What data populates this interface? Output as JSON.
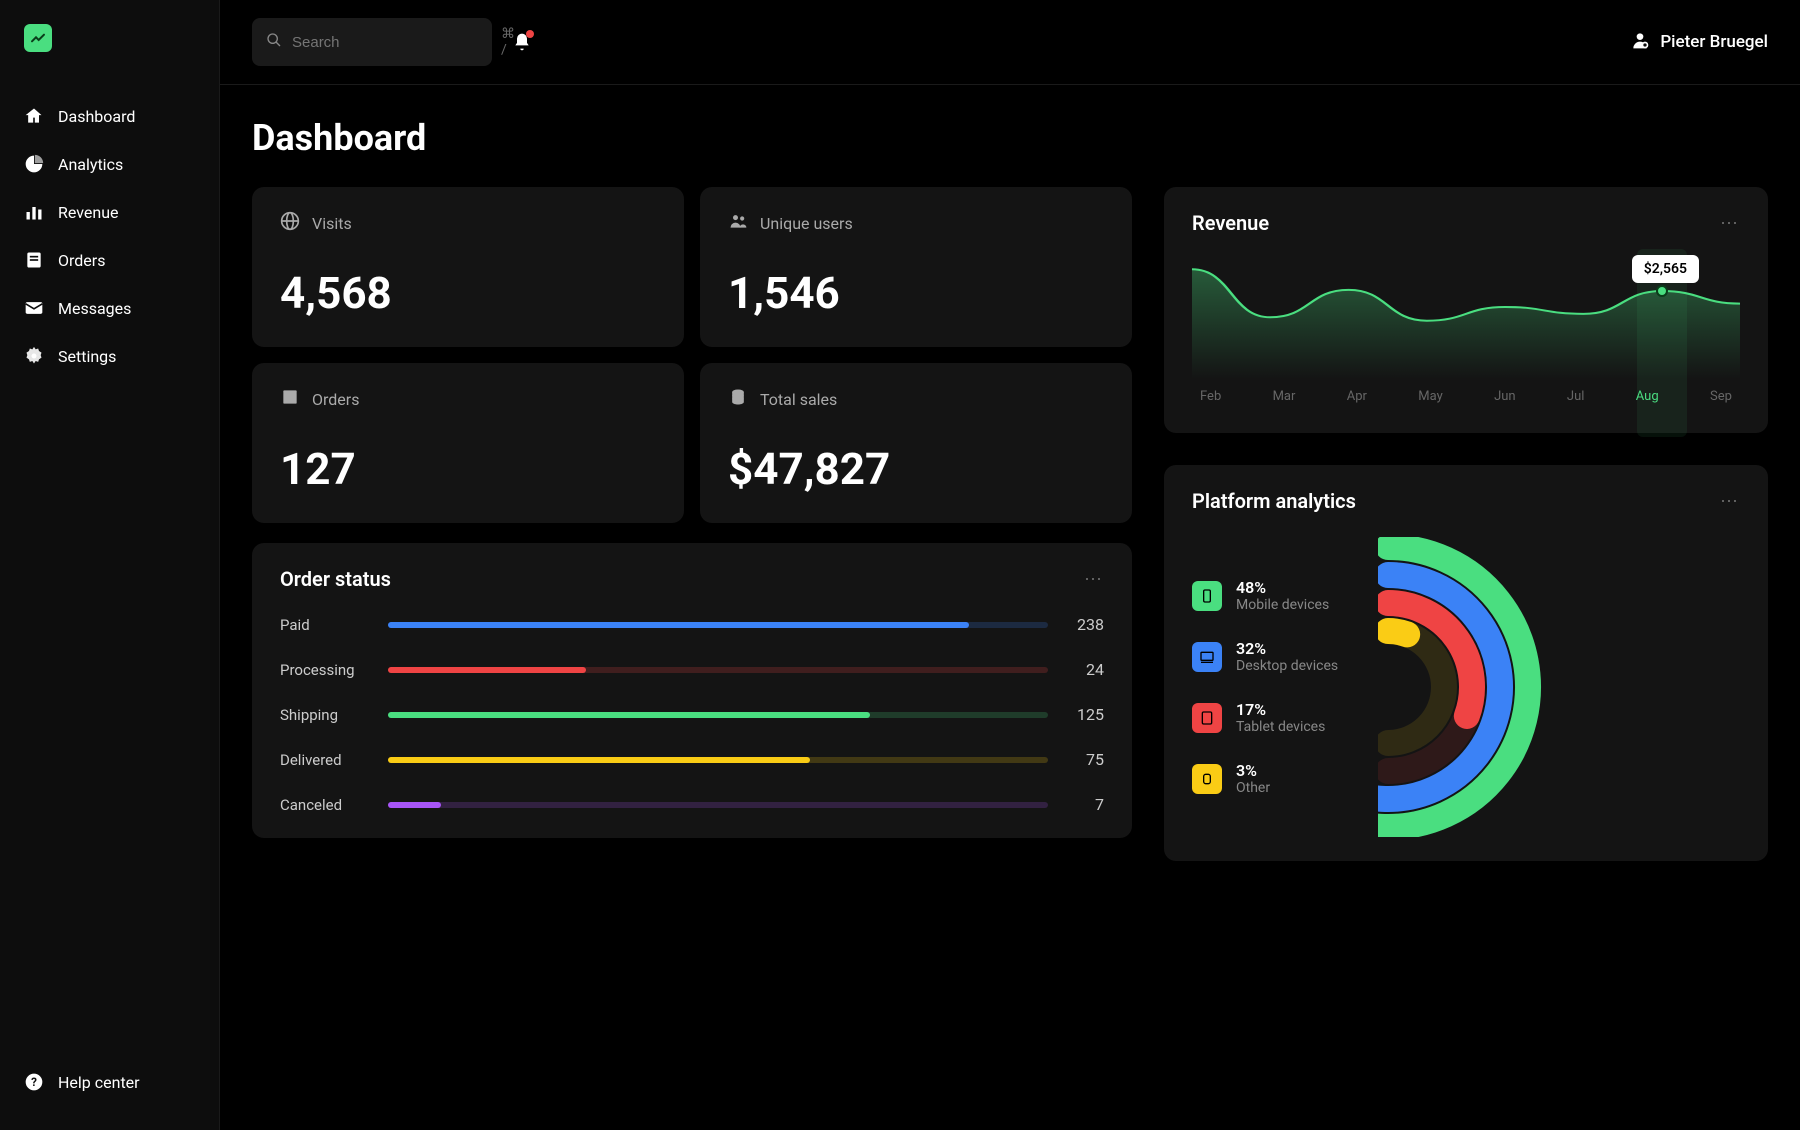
{
  "search": {
    "placeholder": "Search",
    "hint": "⌘ /"
  },
  "user": {
    "name": "Pieter Bruegel"
  },
  "sidebar": {
    "items": [
      {
        "label": "Dashboard"
      },
      {
        "label": "Analytics"
      },
      {
        "label": "Revenue"
      },
      {
        "label": "Orders"
      },
      {
        "label": "Messages"
      },
      {
        "label": "Settings"
      }
    ],
    "help": "Help center"
  },
  "page": {
    "title": "Dashboard"
  },
  "stats": {
    "visits": {
      "label": "Visits",
      "value": "4,568"
    },
    "unique": {
      "label": "Unique users",
      "value": "1,546"
    },
    "orders": {
      "label": "Orders",
      "value": "127"
    },
    "sales": {
      "label": "Total sales",
      "value": "$47,827"
    }
  },
  "order_status": {
    "title": "Order status",
    "rows": [
      {
        "label": "Paid",
        "value": "238",
        "pct": 88,
        "color": "#3b82f6"
      },
      {
        "label": "Processing",
        "value": "24",
        "pct": 30,
        "color": "#ef4444"
      },
      {
        "label": "Shipping",
        "value": "125",
        "pct": 73,
        "color": "#4ade80"
      },
      {
        "label": "Delivered",
        "value": "75",
        "pct": 64,
        "color": "#facc15"
      },
      {
        "label": "Canceled",
        "value": "7",
        "pct": 8,
        "color": "#a855f7"
      }
    ]
  },
  "revenue": {
    "title": "Revenue",
    "tooltip": "$2,565",
    "highlight_month": "Aug"
  },
  "platform": {
    "title": "Platform analytics",
    "items": [
      {
        "pct": "48%",
        "label": "Mobile devices",
        "color": "#4ade80"
      },
      {
        "pct": "32%",
        "label": "Desktop devices",
        "color": "#3b82f6"
      },
      {
        "pct": "17%",
        "label": "Tablet devices",
        "color": "#ef4444"
      },
      {
        "pct": "3%",
        "label": "Other",
        "color": "#facc15"
      }
    ]
  },
  "chart_data": {
    "revenue": {
      "type": "area",
      "categories": [
        "Feb",
        "Mar",
        "Apr",
        "May",
        "Jun",
        "Jul",
        "Aug",
        "Sep"
      ],
      "values": [
        3200,
        1800,
        2600,
        1700,
        2100,
        1900,
        2565,
        2200
      ],
      "tooltip_value": 2565,
      "tooltip_label": "$2,565",
      "highlight_index": 6,
      "ylim": [
        0,
        3500
      ]
    },
    "order_status": {
      "type": "bar",
      "categories": [
        "Paid",
        "Processing",
        "Shipping",
        "Delivered",
        "Canceled"
      ],
      "values": [
        238,
        24,
        125,
        75,
        7
      ]
    },
    "platform": {
      "type": "radial",
      "series": [
        {
          "name": "Mobile devices",
          "value": 48
        },
        {
          "name": "Desktop devices",
          "value": 32
        },
        {
          "name": "Tablet devices",
          "value": 17
        },
        {
          "name": "Other",
          "value": 3
        }
      ]
    }
  }
}
